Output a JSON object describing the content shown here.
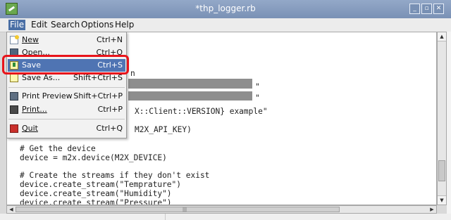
{
  "window": {
    "title": "*thp_logger.rb"
  },
  "menubar": [
    {
      "label": "File",
      "active": true
    },
    {
      "label": "Edit"
    },
    {
      "label": "Search"
    },
    {
      "label": "Options"
    },
    {
      "label": "Help"
    }
  ],
  "file_menu": {
    "items": [
      {
        "label": "New",
        "accel": "Ctrl+N",
        "icon": "new-file-icon"
      },
      {
        "label": "Open...",
        "accel": "Ctrl+O",
        "icon": "open-folder-icon"
      },
      {
        "label": "Save",
        "accel": "Ctrl+S",
        "icon": "save-icon",
        "highlighted": true
      },
      {
        "label": "Save As...",
        "accel": "Shift+Ctrl+S",
        "icon": "save-as-icon"
      },
      {
        "label": "Print Preview",
        "accel": "Shift+Ctrl+P",
        "icon": "print-preview-icon"
      },
      {
        "label": "Print...",
        "accel": "Ctrl+P",
        "icon": "print-icon"
      },
      {
        "label": "Quit",
        "accel": "Ctrl+Q",
        "icon": "quit-icon"
      }
    ]
  },
  "editor": {
    "visible_lines": [
      "n",
      "\"",
      "\"",
      "X::Client::VERSION} example\"",
      "M2X_API_KEY)",
      "# Get the device",
      "device = m2x.device(M2X_DEVICE)",
      "# Create the streams if they don't exist",
      "device.create_stream(\"Temprature\")",
      "device.create_stream(\"Humidity\")",
      "device.create_stream(\"Pressure\")"
    ]
  },
  "colors": {
    "titlebar": "#7a91b5",
    "menu_highlight": "#4f74b3",
    "callout": "#e8141b"
  }
}
